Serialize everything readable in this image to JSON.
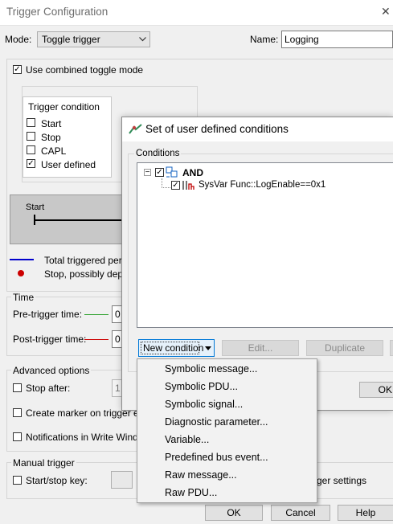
{
  "main": {
    "title": "Trigger Configuration",
    "close_glyph": "✕",
    "mode_label": "Mode:",
    "mode_value": "Toggle trigger",
    "name_label": "Name:",
    "name_value": "Logging",
    "combined_toggle_label": "Use combined toggle mode",
    "trigger_condition": {
      "title": "Trigger condition",
      "items": [
        {
          "label": "Start",
          "checked": false
        },
        {
          "label": "Stop",
          "checked": false
        },
        {
          "label": "CAPL",
          "checked": false
        },
        {
          "label": "User defined",
          "checked": true
        }
      ]
    },
    "diagram_start_label": "Start",
    "legend": {
      "total": "Total triggered perio",
      "stop": "Stop, possibly depen"
    },
    "time": {
      "title": "Time",
      "pre_label": "Pre-trigger time:",
      "pre_value": "0",
      "post_label": "Post-trigger time:",
      "post_value": "0"
    },
    "advanced": {
      "title": "Advanced options",
      "stop_after": "Stop after:",
      "stop_after_value": "1",
      "create_marker": "Create marker on trigger even",
      "notifications": "Notifications in Write Window"
    },
    "manual": {
      "title": "Manual trigger",
      "start_stop_key": "Start/stop key:",
      "settings_fragment": "ger settings"
    },
    "buttons": {
      "ok": "OK",
      "cancel": "Cancel",
      "help": "Help"
    }
  },
  "dialog": {
    "title": "Set of user defined conditions",
    "conditions_label": "Conditions",
    "tree": {
      "root": "AND",
      "child": "SysVar Func::LogEnable==0x1",
      "expander": "−"
    },
    "buttons": {
      "new_condition": "New condition",
      "edit": "Edit...",
      "duplicate": "Duplicate",
      "ok_fragment": "OK"
    }
  },
  "menu": {
    "items": [
      "Symbolic message...",
      "Symbolic PDU...",
      "Symbolic signal...",
      "Diagnostic parameter...",
      "Variable...",
      "Predefined bus event...",
      "Raw message...",
      "Raw PDU..."
    ]
  },
  "colors": {
    "legend_blue": "#0000cc",
    "legend_red": "#cc0000",
    "accent": "#0078d7",
    "window_bg": "#f0f0f0"
  }
}
